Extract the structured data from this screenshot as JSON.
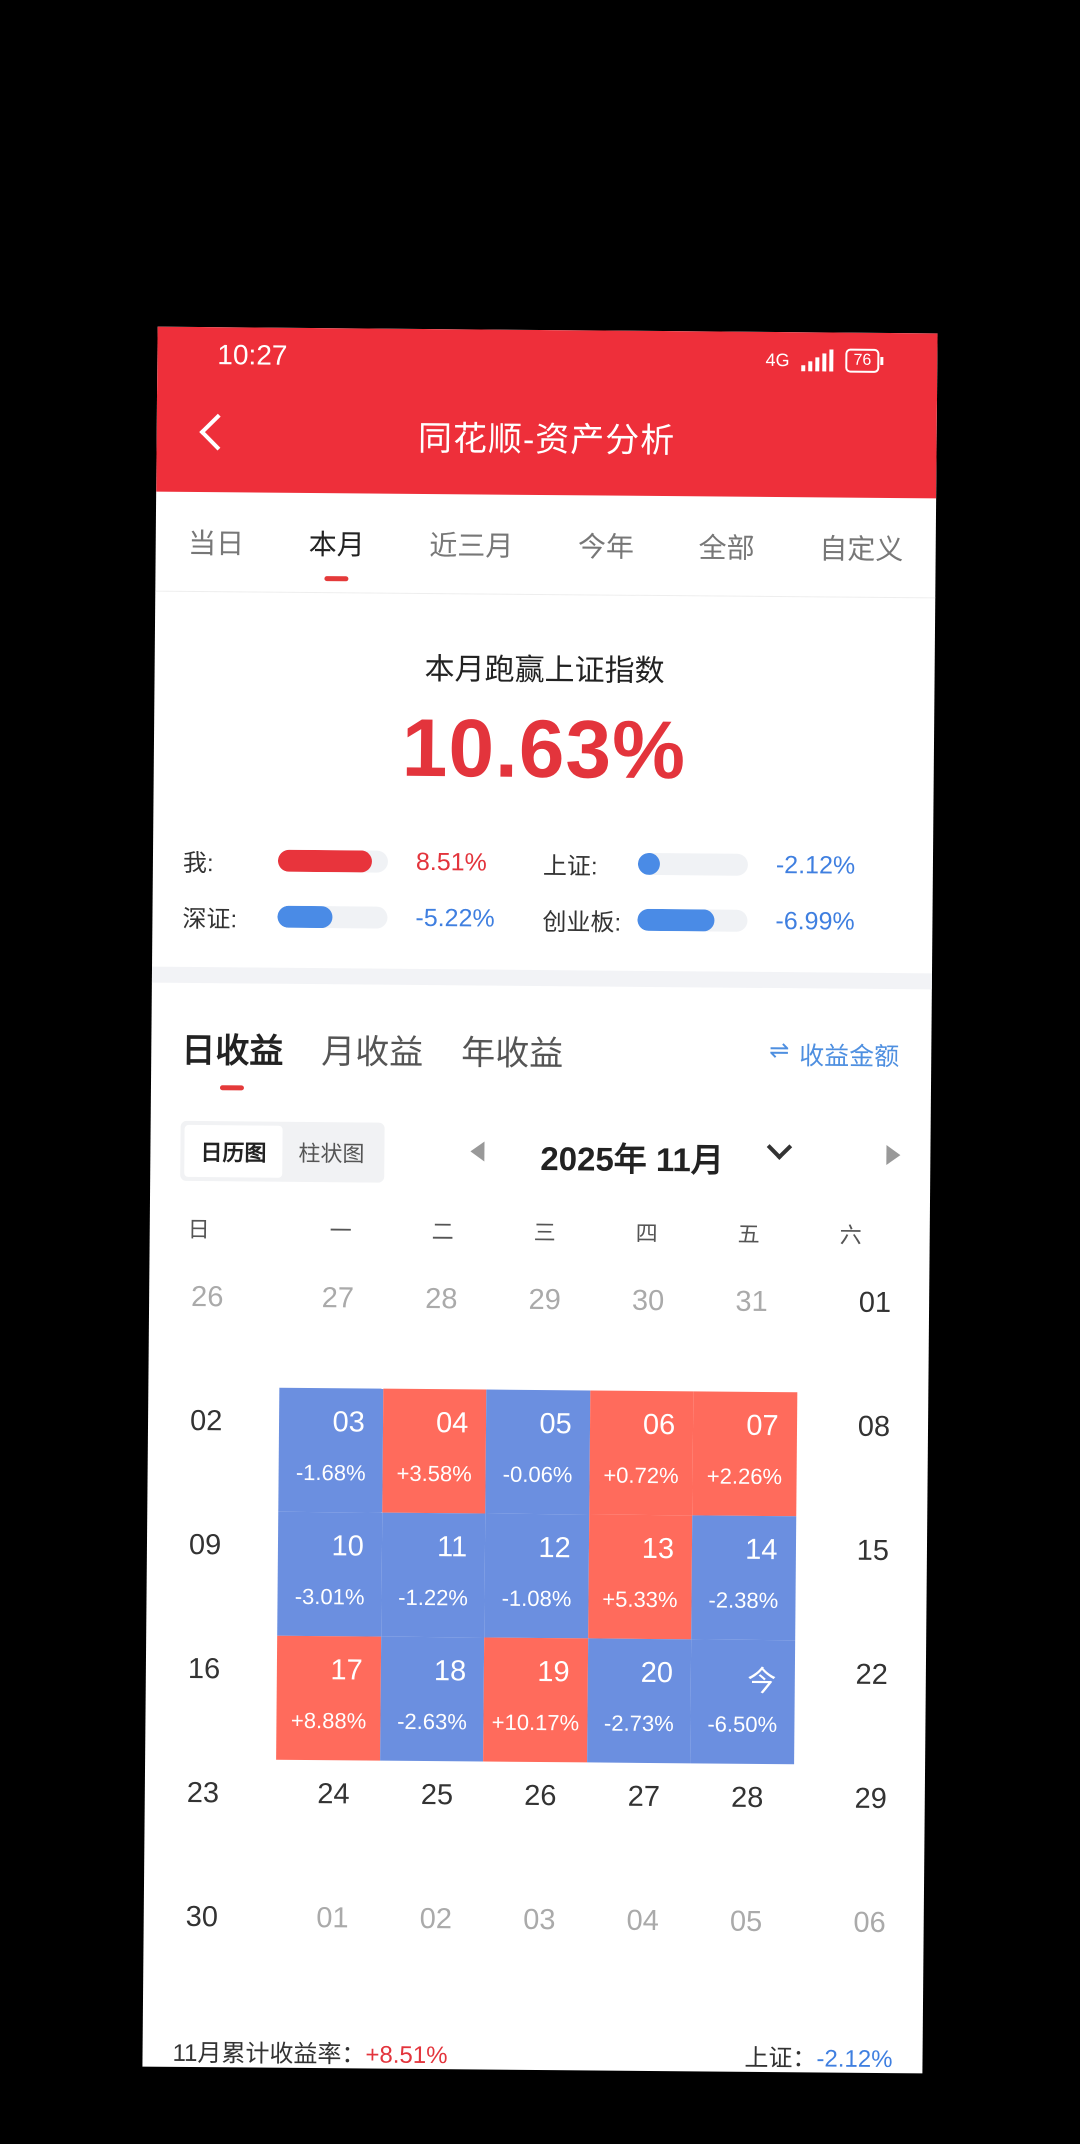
{
  "status": {
    "time": "10:27",
    "network": "4G",
    "battery": "76"
  },
  "header": {
    "title": "同花顺-资产分析"
  },
  "period_tabs": [
    "当日",
    "本月",
    "近三月",
    "今年",
    "全部",
    "自定义"
  ],
  "summary": {
    "title": "本月跑赢上证指数",
    "value": "10.63%",
    "compare": [
      {
        "label": "我:",
        "value": "8.51%",
        "fill": 0.85,
        "color": "#e8343c"
      },
      {
        "label": "上证:",
        "value": "-2.12%",
        "fill": 0.2,
        "color": "#4a8be6"
      },
      {
        "label": "深证:",
        "value": "-5.22%",
        "fill": 0.5,
        "color": "#4a8be6"
      },
      {
        "label": "创业板:",
        "value": "-6.99%",
        "fill": 0.7,
        "color": "#4a8be6"
      }
    ]
  },
  "income_tabs": [
    "日收益",
    "月收益",
    "年收益"
  ],
  "amount_toggle": "收益金额",
  "view_switch": [
    "日历图",
    "柱状图"
  ],
  "month_label": "2025年 11月",
  "weekdays": [
    "日",
    "一",
    "二",
    "三",
    "四",
    "五",
    "六"
  ],
  "calendar": [
    [
      {
        "d": "26",
        "dim": true
      },
      {
        "d": "27",
        "dim": true
      },
      {
        "d": "28",
        "dim": true
      },
      {
        "d": "29",
        "dim": true
      },
      {
        "d": "30",
        "dim": true
      },
      {
        "d": "31",
        "dim": true
      },
      {
        "d": "01"
      }
    ],
    [
      {
        "d": "02"
      },
      {
        "d": "03",
        "p": "-1.68%",
        "c": "blue"
      },
      {
        "d": "04",
        "p": "+3.58%",
        "c": "red"
      },
      {
        "d": "05",
        "p": "-0.06%",
        "c": "blue"
      },
      {
        "d": "06",
        "p": "+0.72%",
        "c": "red"
      },
      {
        "d": "07",
        "p": "+2.26%",
        "c": "red"
      },
      {
        "d": "08"
      }
    ],
    [
      {
        "d": "09"
      },
      {
        "d": "10",
        "p": "-3.01%",
        "c": "blue"
      },
      {
        "d": "11",
        "p": "-1.22%",
        "c": "blue"
      },
      {
        "d": "12",
        "p": "-1.08%",
        "c": "blue"
      },
      {
        "d": "13",
        "p": "+5.33%",
        "c": "red"
      },
      {
        "d": "14",
        "p": "-2.38%",
        "c": "blue"
      },
      {
        "d": "15"
      }
    ],
    [
      {
        "d": "16"
      },
      {
        "d": "17",
        "p": "+8.88%",
        "c": "red"
      },
      {
        "d": "18",
        "p": "-2.63%",
        "c": "blue"
      },
      {
        "d": "19",
        "p": "+10.17%",
        "c": "red"
      },
      {
        "d": "20",
        "p": "-2.73%",
        "c": "blue"
      },
      {
        "d": "今",
        "p": "-6.50%",
        "c": "blue"
      },
      {
        "d": "22"
      }
    ],
    [
      {
        "d": "23"
      },
      {
        "d": "24"
      },
      {
        "d": "25"
      },
      {
        "d": "26"
      },
      {
        "d": "27"
      },
      {
        "d": "28"
      },
      {
        "d": "29"
      }
    ],
    [
      {
        "d": "30"
      },
      {
        "d": "01",
        "dim": true
      },
      {
        "d": "02",
        "dim": true
      },
      {
        "d": "03",
        "dim": true
      },
      {
        "d": "04",
        "dim": true
      },
      {
        "d": "05",
        "dim": true
      },
      {
        "d": "06",
        "dim": true
      }
    ]
  ],
  "footer": {
    "left_label": "11月累计收益率：",
    "left_value": "+8.51%",
    "right_label": "上证：",
    "right_value": "-2.12%"
  }
}
